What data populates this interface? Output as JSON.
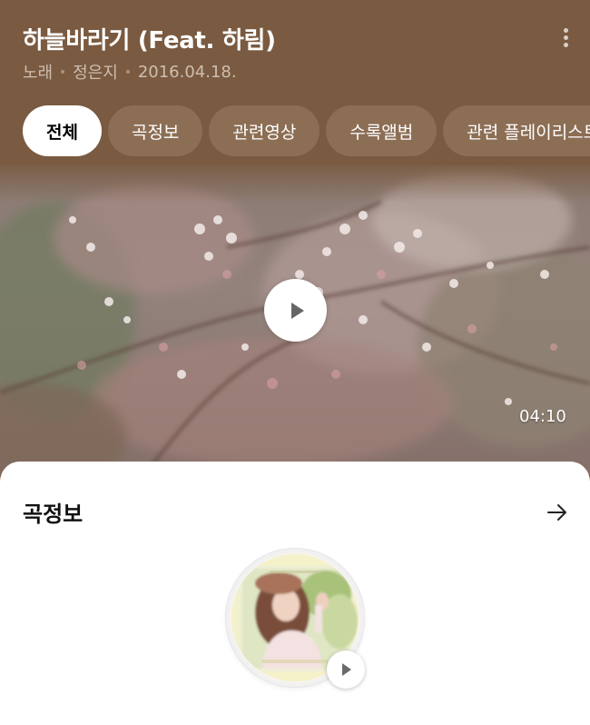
{
  "song": {
    "title": "하늘바라기 (Feat. 하림)",
    "type": "노래",
    "artist": "정은지",
    "release_date": "2016.04.18."
  },
  "tabs": [
    {
      "label": "전체",
      "active": true
    },
    {
      "label": "곡정보",
      "active": false
    },
    {
      "label": "관련영상",
      "active": false
    },
    {
      "label": "수록앨범",
      "active": false
    },
    {
      "label": "관련 플레이리스트",
      "active": false
    }
  ],
  "video": {
    "duration": "04:10",
    "play_icon": "play-icon"
  },
  "song_info_section": {
    "title": "곡정보",
    "arrow_icon": "arrow-right-icon",
    "album_play_icon": "play-icon"
  },
  "colors": {
    "header_bg": "#7a5a40",
    "tab_bg": "#8c6e55",
    "tab_active_bg": "#ffffff",
    "meta_text": "#cdbfb2"
  }
}
